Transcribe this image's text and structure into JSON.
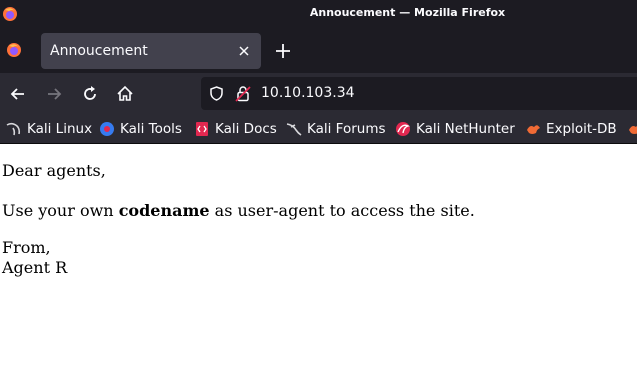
{
  "window": {
    "title": "Annoucement — Mozilla Firefox"
  },
  "tab": {
    "label": "Annoucement"
  },
  "navigation": {
    "url": "10.10.103.34"
  },
  "bookmarks": [
    {
      "label": "Kali Linux",
      "icon": "kali-dragon-icon"
    },
    {
      "label": "Kali Tools",
      "icon": "kali-tools-icon"
    },
    {
      "label": "Kali Docs",
      "icon": "kali-docs-icon"
    },
    {
      "label": "Kali Forums",
      "icon": "kali-forums-icon"
    },
    {
      "label": "Kali NetHunter",
      "icon": "kali-nethunter-icon"
    },
    {
      "label": "Exploit-DB",
      "icon": "exploit-db-icon"
    }
  ],
  "page": {
    "greeting": "Dear agents,",
    "message_before": "Use your own ",
    "message_bold": "codename",
    "message_after": " as user-agent to access the site.",
    "closing": "From,",
    "signature": "Agent R"
  },
  "colors": {
    "titlebar": "#1c1b22",
    "toolbar": "#2b2a33",
    "tab_active": "#42414d",
    "text_light": "#fbfbfe"
  }
}
